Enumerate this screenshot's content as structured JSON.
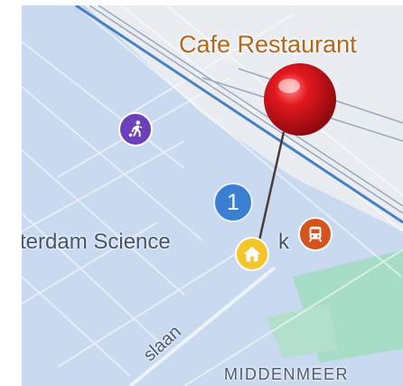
{
  "map": {
    "poi_label": "Cafe Restaurant",
    "area_label": "terdam Science",
    "area_label_tail": "k",
    "district_label": "MIDDENMEER",
    "street_label": "slaan",
    "cluster_count": "1"
  },
  "icons": {
    "sport": "soccer-player-icon",
    "home": "home-icon",
    "train": "train-icon",
    "pin": "red-map-pin-icon"
  },
  "colors": {
    "water": "#c9d9ef",
    "park": "#a7dcc6",
    "pin": "#d9151c",
    "poi_text": "#b4661d",
    "sport_marker": "#6c3fbb",
    "cluster_marker": "#3b7fd3",
    "home_marker": "#f4c62b",
    "train_marker": "#d4541f"
  }
}
